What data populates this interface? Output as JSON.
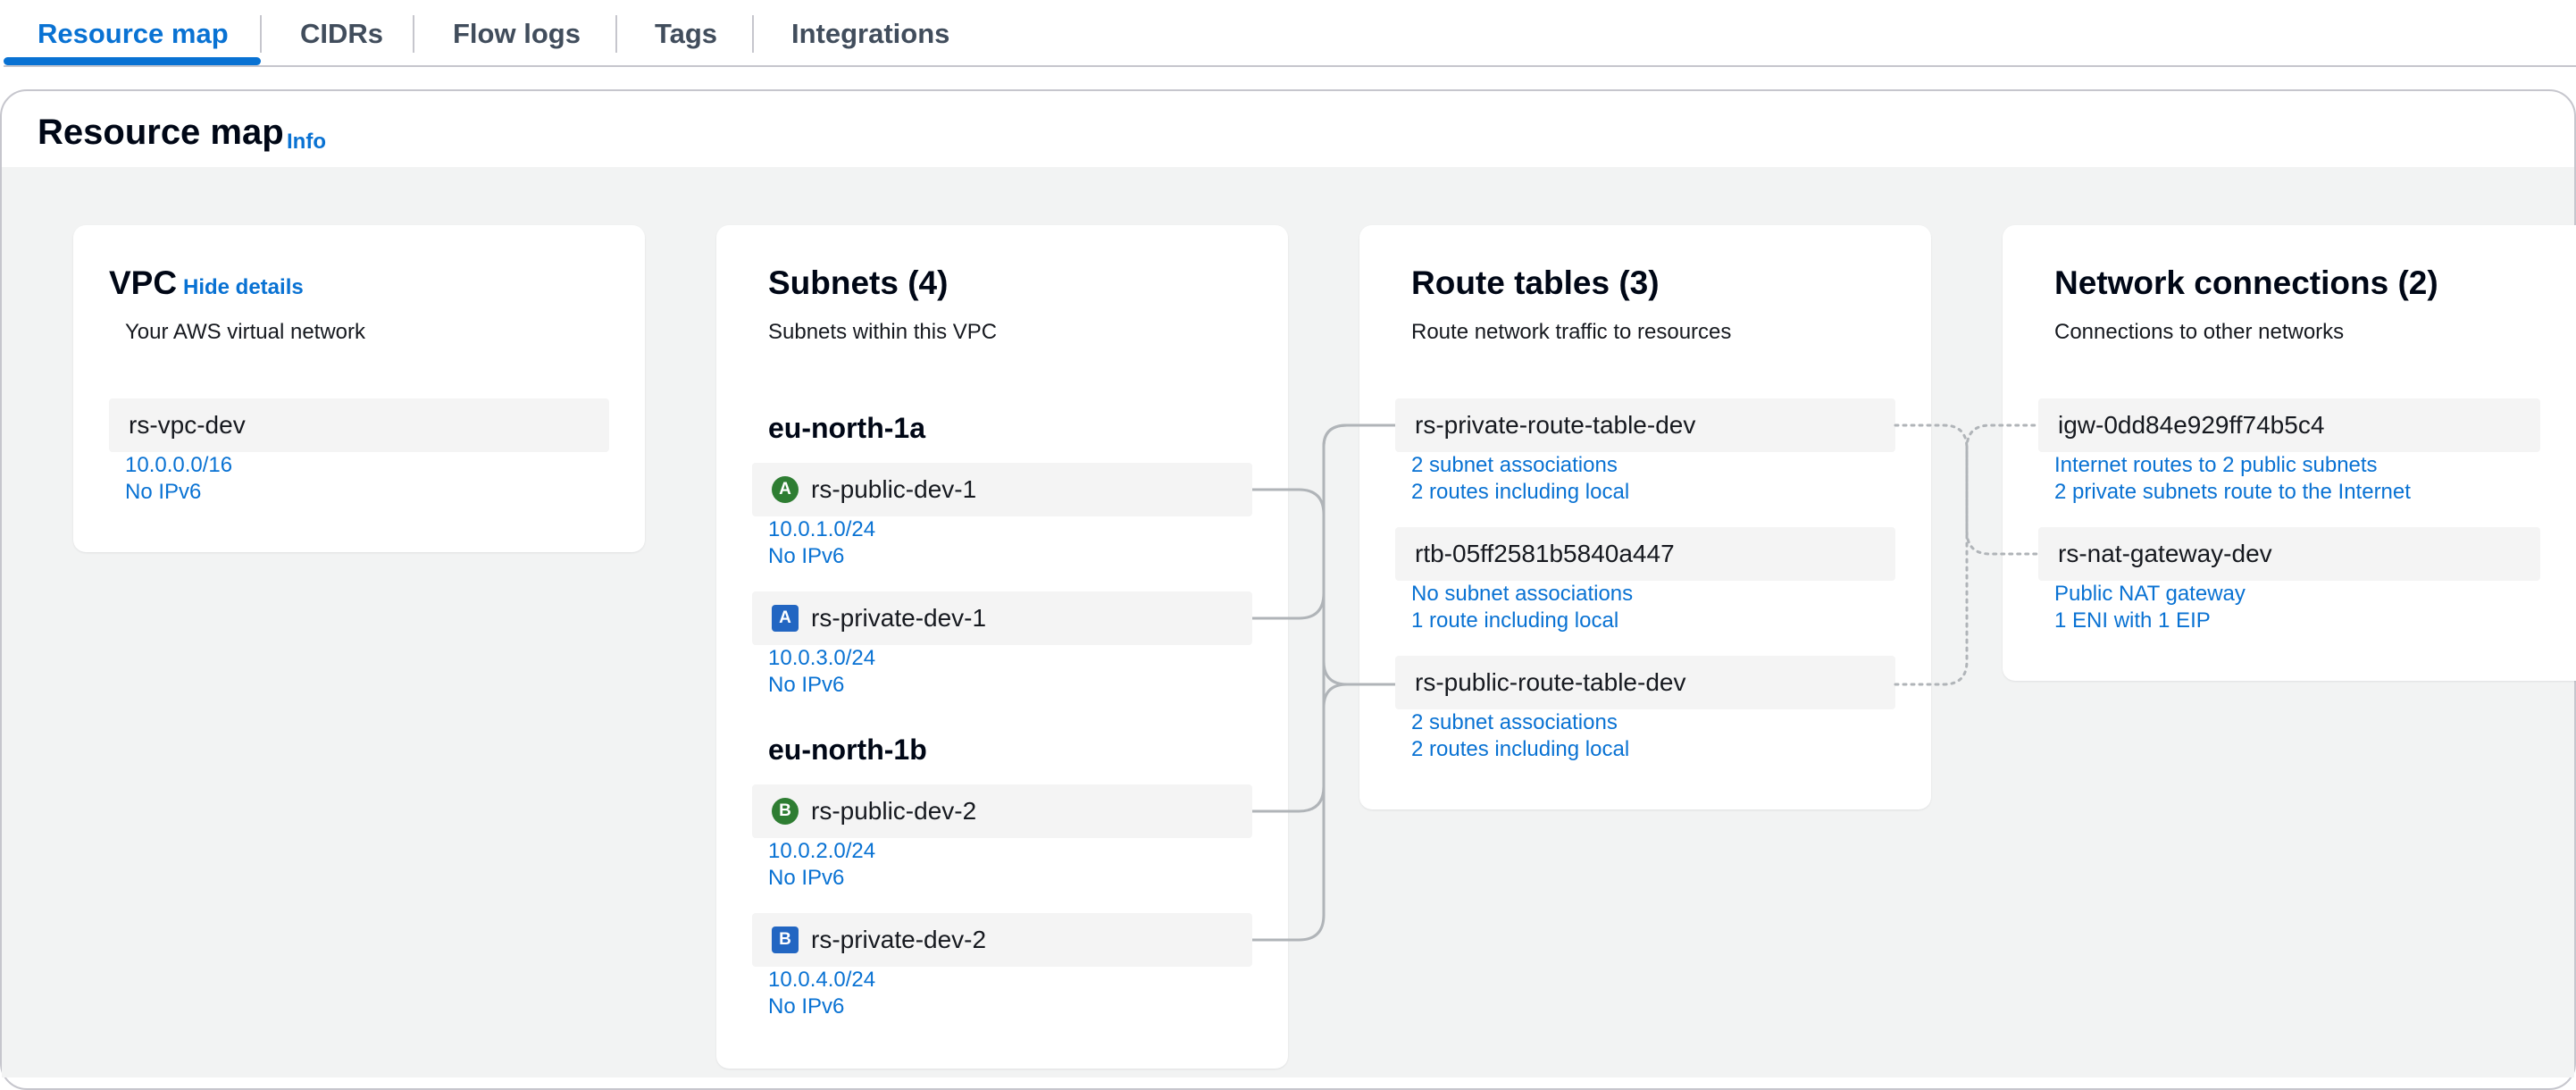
{
  "tabs": [
    {
      "label": "Resource map"
    },
    {
      "label": "CIDRs"
    },
    {
      "label": "Flow logs"
    },
    {
      "label": "Tags"
    },
    {
      "label": "Integrations"
    }
  ],
  "header": {
    "title": "Resource map",
    "info_label": "Info"
  },
  "vpc": {
    "title": "VPC",
    "hide_details_label": "Hide details",
    "subtitle": "Your AWS virtual network",
    "name": "rs-vpc-dev",
    "cidr": "10.0.0.0/16",
    "ipv6": "No IPv6"
  },
  "subnets": {
    "title": "Subnets (4)",
    "subtitle": "Subnets within this VPC",
    "zones": [
      {
        "name": "eu-north-1a",
        "items": [
          {
            "badge": "A",
            "name": "rs-public-dev-1",
            "cidr": "10.0.1.0/24",
            "ipv6": "No IPv6"
          },
          {
            "badge": "A",
            "name": "rs-private-dev-1",
            "cidr": "10.0.3.0/24",
            "ipv6": "No IPv6"
          }
        ]
      },
      {
        "name": "eu-north-1b",
        "items": [
          {
            "badge": "B",
            "name": "rs-public-dev-2",
            "cidr": "10.0.2.0/24",
            "ipv6": "No IPv6"
          },
          {
            "badge": "B",
            "name": "rs-private-dev-2",
            "cidr": "10.0.4.0/24",
            "ipv6": "No IPv6"
          }
        ]
      }
    ]
  },
  "route_tables": {
    "title": "Route tables (3)",
    "subtitle": "Route network traffic to resources",
    "items": [
      {
        "name": "rs-private-route-table-dev",
        "line1": "2 subnet associations",
        "line2": "2 routes including local"
      },
      {
        "name": "rtb-05ff2581b5840a447",
        "line1": "No subnet associations",
        "line2": "1 route including local"
      },
      {
        "name": "rs-public-route-table-dev",
        "line1": "2 subnet associations",
        "line2": "2 routes including local"
      }
    ]
  },
  "network_connections": {
    "title": "Network connections (2)",
    "subtitle": "Connections to other networks",
    "items": [
      {
        "name": "igw-0dd84e929ff74b5c4",
        "line1": "Internet routes to 2 public subnets",
        "line2": "2 private subnets route to the Internet"
      },
      {
        "name": "rs-nat-gateway-dev",
        "line1": "Public NAT gateway",
        "line2": "1 ENI with 1 EIP"
      }
    ]
  },
  "colors": {
    "accent": "#0972d3",
    "public_badge": "#2e7d32",
    "private_badge": "#2266c2",
    "connector": "#b0b4b8"
  }
}
